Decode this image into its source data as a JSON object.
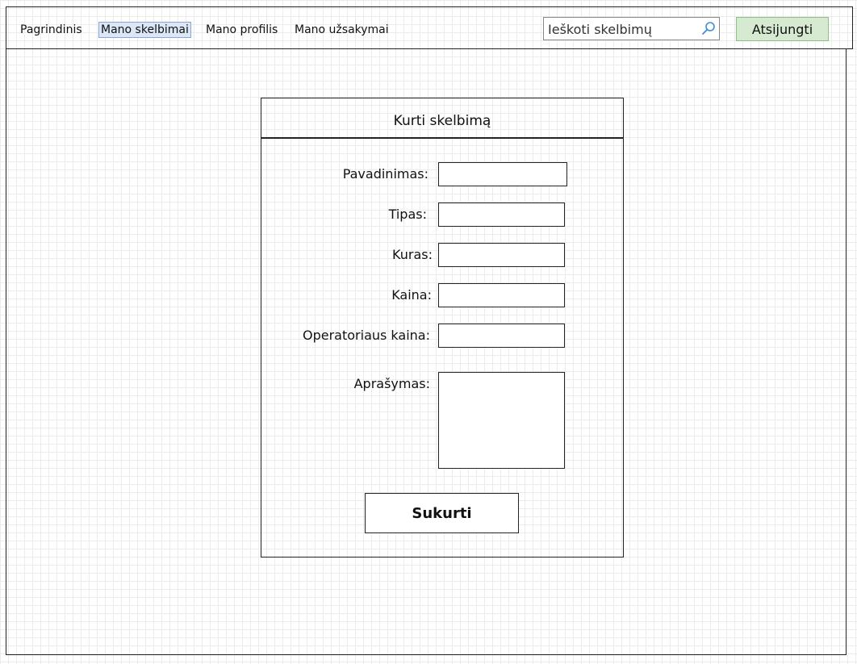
{
  "nav": {
    "items": [
      {
        "label": "Pagrindinis"
      },
      {
        "label": "Mano skelbimai"
      },
      {
        "label": "Mano profilis"
      },
      {
        "label": "Mano užsakymai"
      }
    ],
    "active_item": "Mano skelbimai",
    "search_placeholder": "Ieškoti skelbimų",
    "logout_label": "Atsijungti"
  },
  "form": {
    "title": "Kurti skelbimą",
    "fields": [
      {
        "label": "Pavadinimas:",
        "value": ""
      },
      {
        "label": "Tipas:",
        "value": ""
      },
      {
        "label": "Kuras:",
        "value": ""
      },
      {
        "label": "Kaina:",
        "value": ""
      },
      {
        "label": "Operatoriaus kaina:",
        "value": ""
      },
      {
        "label": "Aprašymas:",
        "value": ""
      }
    ],
    "submit_label": "Sukurti"
  },
  "colors": {
    "active_nav_bg": "#dbe7f7",
    "logout_bg": "#d5ead0",
    "search_icon": "#3a8fd8"
  },
  "icons": [
    "search-icon"
  ]
}
